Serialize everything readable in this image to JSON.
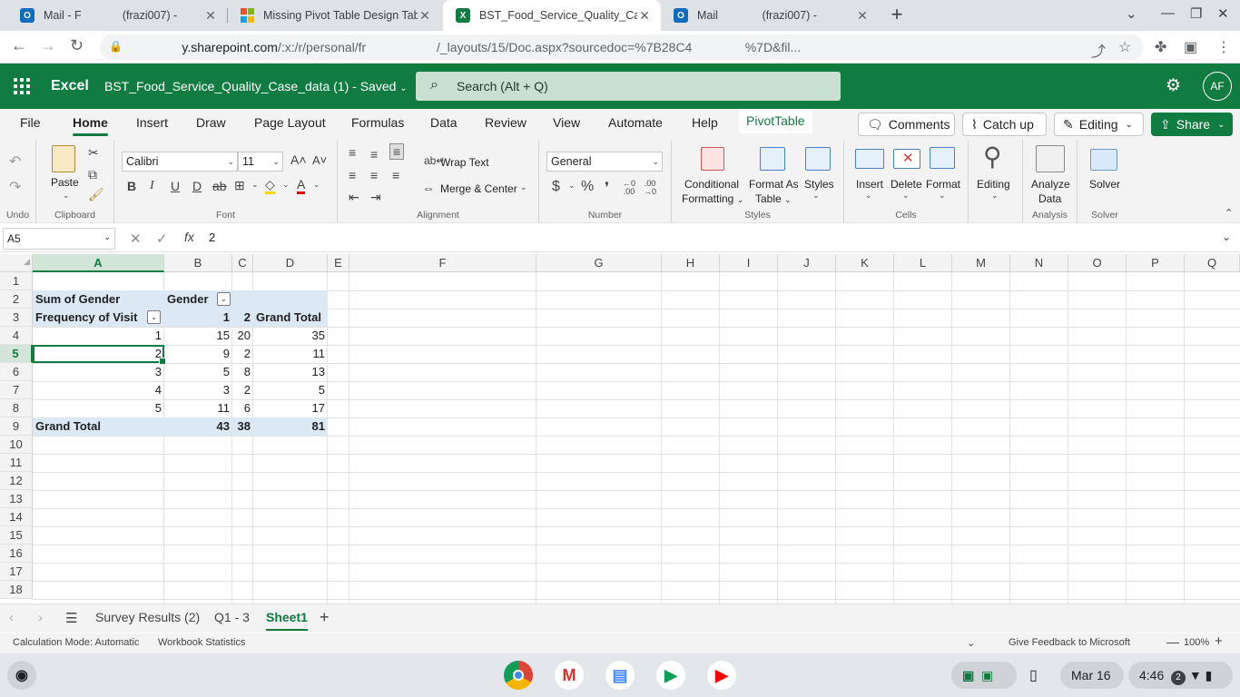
{
  "browser": {
    "tabs": [
      {
        "title": "Mail - F",
        "title_tail": "(frazi007) -",
        "favicon": "outlook-icon",
        "color": "#0f6cbd"
      },
      {
        "title": "Missing Pivot Table Design Tab -",
        "favicon": "microsoft-icon",
        "color": "#f25022"
      },
      {
        "title": "BST_Food_Service_Quality_Case",
        "favicon": "excel-icon",
        "color": "#107c41"
      },
      {
        "title": "Mail",
        "title_tail": "(frazi007) -",
        "favicon": "outlook-icon",
        "color": "#0f6cbd"
      }
    ],
    "url_prefix": "y.sharepoint.com",
    "url": "/:x:/r/personal/fr",
    "url_rest": "/_layouts/15/Doc.aspx?sourcedoc=%7B28C4",
    "url_end": "%7D&fil..."
  },
  "excel": {
    "app_name": "Excel",
    "doc_title": "BST_Food_Service_Quality_Case_data (1)",
    "doc_status": "-  Saved",
    "search_placeholder": "Search (Alt + Q)",
    "avatar": "AF",
    "accent": "#107c41"
  },
  "ribbon_tabs": [
    "File",
    "Home",
    "Insert",
    "Draw",
    "Page Layout",
    "Formulas",
    "Data",
    "Review",
    "View",
    "Automate",
    "Help",
    "PivotTable"
  ],
  "ribbon_buttons": {
    "comments": "Comments",
    "catchup": "Catch up",
    "editing": "Editing",
    "share": "Share"
  },
  "ribbon": {
    "undo_group": "Undo",
    "clipboard": {
      "paste": "Paste",
      "group": "Clipboard"
    },
    "font": {
      "name": "Calibri",
      "size": "11",
      "group": "Font"
    },
    "alignment": {
      "wrap": "Wrap Text",
      "merge": "Merge & Center",
      "group": "Alignment"
    },
    "number": {
      "format": "General",
      "group": "Number"
    },
    "styles": {
      "conditional": "Conditional",
      "conditional2": "Formatting",
      "format_as": "Format As",
      "format_as2": "Table",
      "styles": "Styles",
      "group": "Styles"
    },
    "cells": {
      "insert": "Insert",
      "delete": "Delete",
      "format": "Format",
      "group": "Cells"
    },
    "editing": {
      "label": "Editing"
    },
    "analysis": {
      "label": "Analyze",
      "label2": "Data",
      "group": "Analysis"
    },
    "solver": {
      "label": "Solver",
      "group": "Solver"
    }
  },
  "formula_bar": {
    "name_box": "A5",
    "value": "2"
  },
  "grid": {
    "columns": [
      "A",
      "B",
      "C",
      "D",
      "E",
      "F",
      "G",
      "H",
      "I",
      "J",
      "K",
      "L",
      "M",
      "N",
      "O",
      "P",
      "Q"
    ],
    "rows": [
      "1",
      "2",
      "3",
      "4",
      "5",
      "6",
      "7",
      "8",
      "9",
      "10",
      "11",
      "12",
      "13",
      "14",
      "15",
      "16",
      "17",
      "18"
    ],
    "selected_cell": "A5"
  },
  "pivot": {
    "value_field": "Sum of Gender",
    "column_field": "Gender",
    "row_field": "Frequency of Visit",
    "column_items": [
      "1",
      "2",
      "Grand Total"
    ],
    "rows": [
      {
        "label": "1",
        "values": [
          "15",
          "20",
          "35"
        ]
      },
      {
        "label": "2",
        "values": [
          "9",
          "2",
          "11"
        ]
      },
      {
        "label": "3",
        "values": [
          "5",
          "8",
          "13"
        ]
      },
      {
        "label": "4",
        "values": [
          "3",
          "2",
          "5"
        ]
      },
      {
        "label": "5",
        "values": [
          "11",
          "6",
          "17"
        ]
      }
    ],
    "grand_total": {
      "label": "Grand Total",
      "values": [
        "43",
        "38",
        "81"
      ]
    },
    "fill_color": "#dce9f4"
  },
  "sheets": [
    "Survey Results (2)",
    "Q1 - 3",
    "Sheet1"
  ],
  "active_sheet": "Sheet1",
  "status": {
    "calc_mode": "Calculation Mode: Automatic",
    "stats": "Workbook Statistics",
    "feedback": "Give Feedback to Microsoft",
    "zoom": "100%"
  },
  "shelf": {
    "date": "Mar 16",
    "time": "4:46",
    "badge": "2"
  }
}
